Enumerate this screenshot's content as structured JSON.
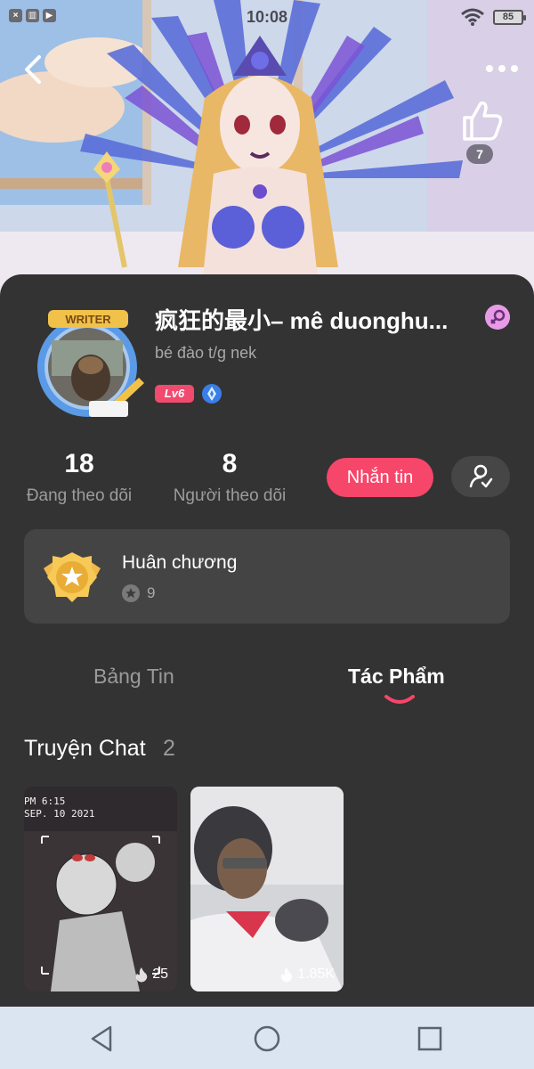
{
  "status_bar": {
    "time": "10:08",
    "battery": "85"
  },
  "cover": {
    "like_count": "7"
  },
  "profile": {
    "name": "疯狂的最小– mê duonghu...",
    "bio": "bé đào t/g nek",
    "level": "Lv6",
    "avatar_frame_label": "WRITER"
  },
  "stats": {
    "following_count": "18",
    "following_label": "Đang theo dõi",
    "followers_count": "8",
    "followers_label": "Người theo dõi"
  },
  "actions": {
    "message_label": "Nhắn tin"
  },
  "medals": {
    "title": "Huân chương",
    "count": "9"
  },
  "tabs": [
    {
      "label": "Bảng Tin",
      "active": false
    },
    {
      "label": "Tác Phẩm",
      "active": true
    }
  ],
  "works": {
    "section_title": "Truyện Chat",
    "section_count": "2",
    "items": [
      {
        "views": "25",
        "stamp_line1": "PM  6:15",
        "stamp_line2": "SEP. 10  2021"
      },
      {
        "views": "1.85K"
      }
    ]
  },
  "colors": {
    "accent": "#f6466a",
    "panel": "#333333",
    "card": "#444444",
    "navbar": "#dbe4f1"
  }
}
